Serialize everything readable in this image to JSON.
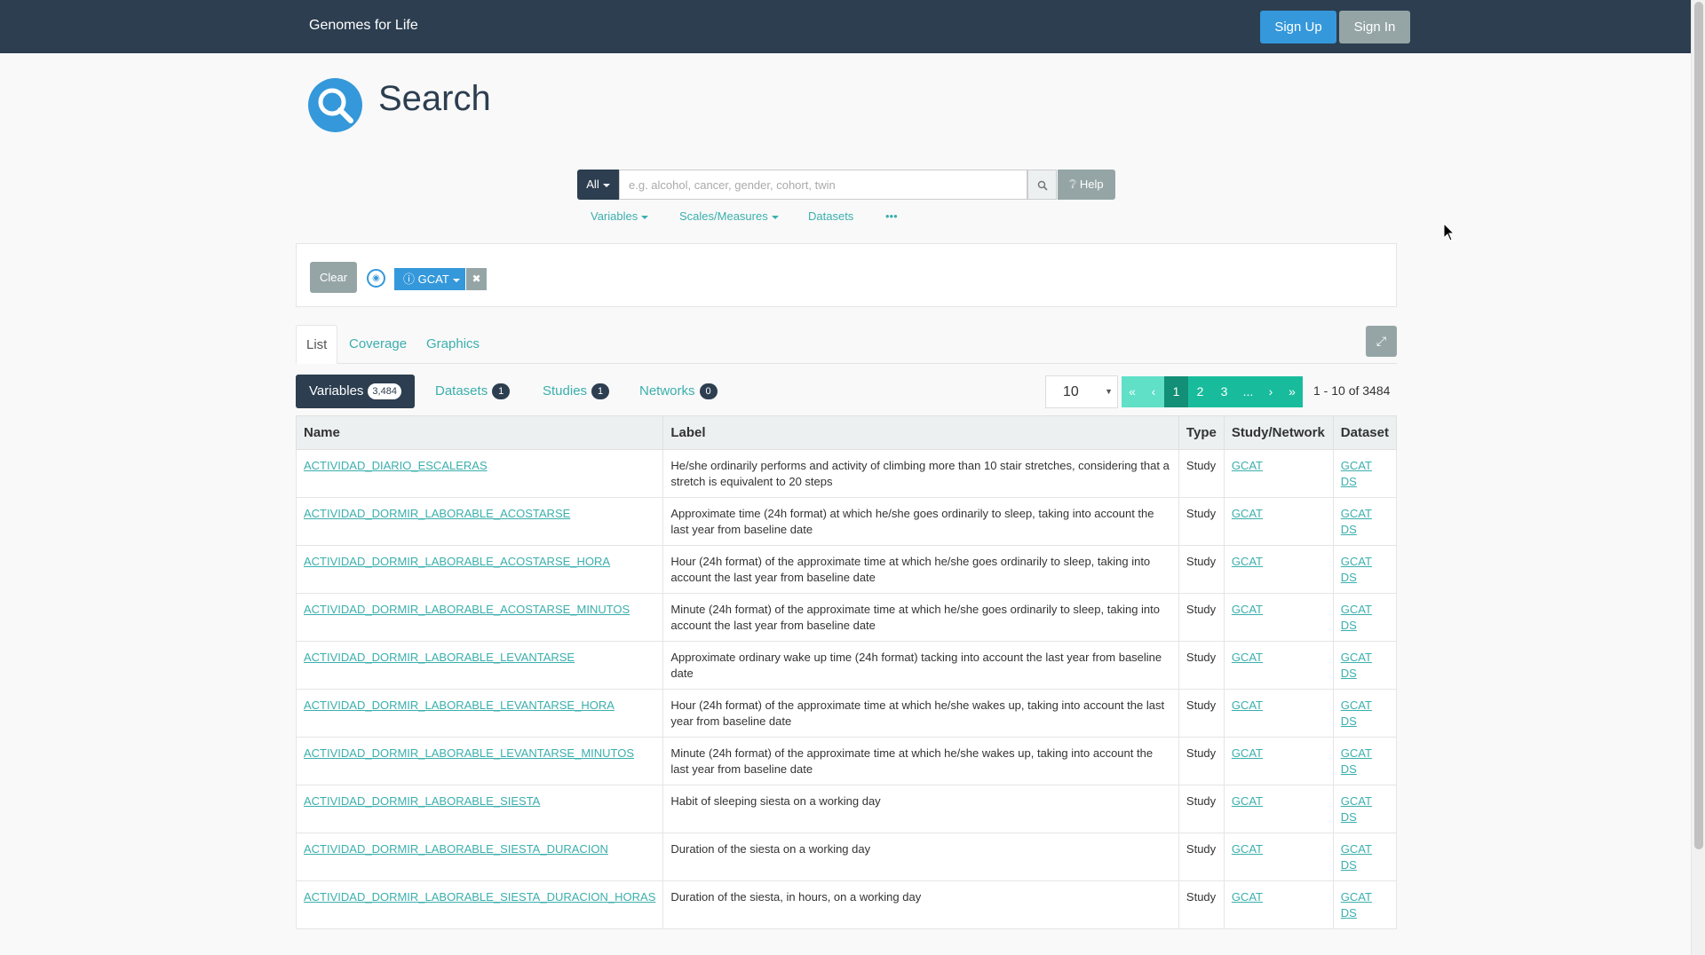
{
  "app": {
    "brand": "Genomes for Life",
    "sign_up": "Sign Up",
    "sign_in": "Sign In"
  },
  "page": {
    "title": "Search"
  },
  "search": {
    "scope": "All",
    "placeholder": "e.g. alcohol, cancer, gender, cohort, twin",
    "help": "Help",
    "subnav": [
      "Variables",
      "Scales/Measures",
      "Datasets",
      "•••"
    ]
  },
  "filters": {
    "clear": "Clear",
    "chip": "GCAT"
  },
  "tabs": [
    "List",
    "Coverage",
    "Graphics"
  ],
  "pills": [
    {
      "label": "Variables",
      "count": "3,484"
    },
    {
      "label": "Datasets",
      "count": "1"
    },
    {
      "label": "Studies",
      "count": "1"
    },
    {
      "label": "Networks",
      "count": "0"
    }
  ],
  "pagination": {
    "page_size": "10",
    "pages": [
      "«",
      "‹",
      "1",
      "2",
      "3",
      "...",
      "›",
      "»"
    ],
    "range": "1 - 10 of 3484"
  },
  "table": {
    "headers": [
      "Name",
      "Label",
      "Type",
      "Study/Network",
      "Dataset"
    ],
    "rows": [
      {
        "name": "ACTIVIDAD_DIARIO_ESCALERAS",
        "label": "He/she ordinarily performs and activity of climbing more than 10 stair stretches, considering that a stretch is equivalent to 20 steps",
        "type": "Study",
        "study": "GCAT",
        "dataset": "GCAT DS"
      },
      {
        "name": "ACTIVIDAD_DORMIR_LABORABLE_ACOSTARSE",
        "label": "Approximate time (24h format) at which he/she goes ordinarily to sleep, taking into account the last year from baseline date",
        "type": "Study",
        "study": "GCAT",
        "dataset": "GCAT DS"
      },
      {
        "name": "ACTIVIDAD_DORMIR_LABORABLE_ACOSTARSE_HORA",
        "label": "Hour (24h format) of the approximate time at which he/she goes ordinarily to sleep, taking into account the last year from baseline date",
        "type": "Study",
        "study": "GCAT",
        "dataset": "GCAT DS"
      },
      {
        "name": "ACTIVIDAD_DORMIR_LABORABLE_ACOSTARSE_MINUTOS",
        "label": "Minute (24h format) of the approximate time at which he/she goes ordinarily to sleep, taking into account the last year from baseline date",
        "type": "Study",
        "study": "GCAT",
        "dataset": "GCAT DS"
      },
      {
        "name": "ACTIVIDAD_DORMIR_LABORABLE_LEVANTARSE",
        "label": "Approximate ordinary wake up time (24h format) tacking into account the last year from baseline date",
        "type": "Study",
        "study": "GCAT",
        "dataset": "GCAT DS"
      },
      {
        "name": "ACTIVIDAD_DORMIR_LABORABLE_LEVANTARSE_HORA",
        "label": "Hour (24h format) of the approximate time at which he/she wakes up, taking into account the last year from baseline date",
        "type": "Study",
        "study": "GCAT",
        "dataset": "GCAT DS"
      },
      {
        "name": "ACTIVIDAD_DORMIR_LABORABLE_LEVANTARSE_MINUTOS",
        "label": "Minute (24h format) of the approximate time at which he/she wakes up, taking into account the last year from baseline date",
        "type": "Study",
        "study": "GCAT",
        "dataset": "GCAT DS"
      },
      {
        "name": "ACTIVIDAD_DORMIR_LABORABLE_SIESTA",
        "label": "Habit of sleeping siesta on a working day",
        "type": "Study",
        "study": "GCAT",
        "dataset": "GCAT DS"
      },
      {
        "name": "ACTIVIDAD_DORMIR_LABORABLE_SIESTA_DURACION",
        "label": "Duration of the siesta on a working day",
        "type": "Study",
        "study": "GCAT",
        "dataset": "GCAT DS"
      },
      {
        "name": "ACTIVIDAD_DORMIR_LABORABLE_SIESTA_DURACION_HORAS",
        "label": "Duration of the siesta, in hours, on a working day",
        "type": "Study",
        "study": "GCAT",
        "dataset": "GCAT DS"
      }
    ]
  },
  "colors": {
    "navbar": "#2c3e50",
    "primary": "#3498db",
    "link": "#3bafad",
    "success": "#18bc9c",
    "muted": "#95a5a6"
  },
  "icons": {
    "logo": "search-icon",
    "search": "magnifier-icon",
    "help": "question-circle-icon",
    "expand": "expand-icon",
    "network": "network-icon",
    "info": "info-icon",
    "remove": "close-icon"
  }
}
